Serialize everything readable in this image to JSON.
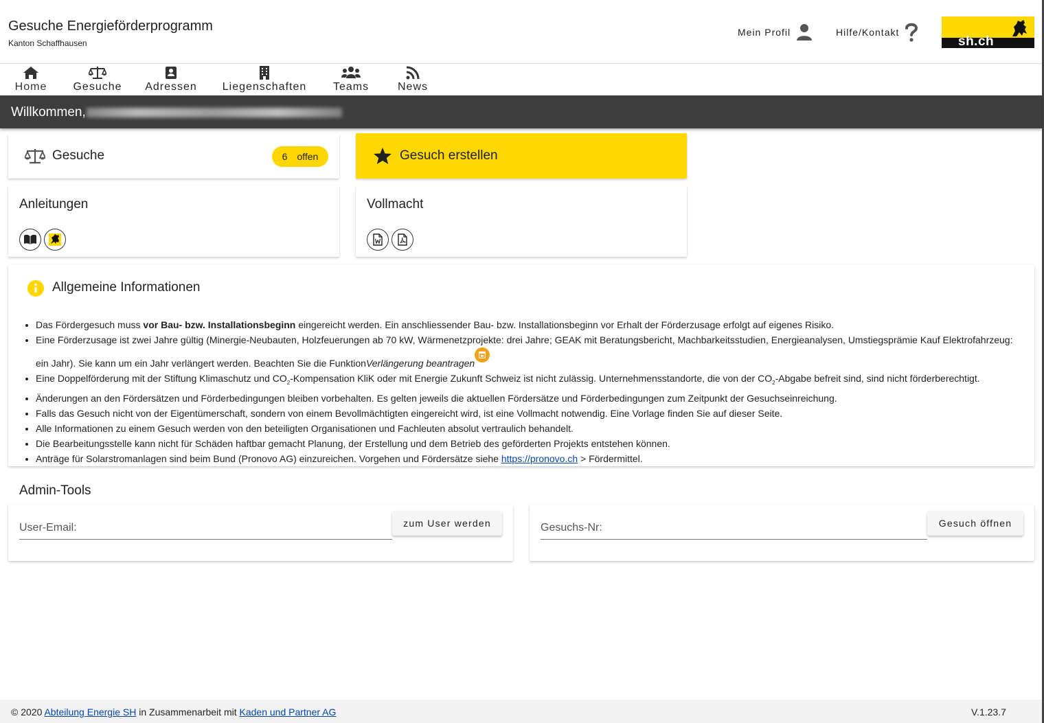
{
  "header": {
    "title": "Gesuche Energieförderprogramm",
    "subtitle": "Kanton Schaffhausen",
    "profile_label": "Mein Profil",
    "help_label": "Hilfe/Kontakt",
    "logo_text": "sh.ch"
  },
  "nav": {
    "items": [
      {
        "label": "Home",
        "icon": "home-icon"
      },
      {
        "label": "Gesuche",
        "icon": "scale-icon"
      },
      {
        "label": "Adressen",
        "icon": "address-book-icon"
      },
      {
        "label": "Liegenschaften",
        "icon": "building-icon"
      },
      {
        "label": "Teams",
        "icon": "users-icon"
      },
      {
        "label": "News",
        "icon": "rss-icon"
      }
    ],
    "active": "Home"
  },
  "welcome": {
    "text": "Willkommen,"
  },
  "cards": {
    "gesuche": {
      "title": "Gesuche",
      "count": "6",
      "count_label": "offen"
    },
    "create": {
      "title": "Gesuch erstellen"
    },
    "anleitungen": {
      "title": "Anleitungen",
      "icons": [
        "book-icon",
        "canton-logo-icon"
      ]
    },
    "vollmacht": {
      "title": "Vollmacht",
      "icons": [
        "word-file-icon",
        "pdf-file-icon"
      ]
    }
  },
  "info": {
    "title": "Allgemeine Informationen",
    "items": {
      "i1_pre": "Das Fördergesuch muss ",
      "i1_bold": "vor Bau- bzw. Installationsbeginn",
      "i1_post": " eingereicht werden. Ein anschliessender Bau- bzw. Installationsbeginn vor Erhalt der Förderzusage erfolgt auf eigenes Risiko.",
      "i2_a": "Eine Förderzusage ist zwei Jahre gültig (Minergie-Neubauten, Holzfeuerungen ab 70 kW, Wärmenetzprojekte: drei Jahre; GEAK mit Beratungsbericht, Machbarkeitsstudien, Energieanalysen, Umstiegsprämie Kauf Elektrofahrzeug:",
      "i2_b": "ein Jahr). Sie kann um ein Jahr verlängert werden. Beachten Sie die Funktion ",
      "i2_italic": "Verlängerung beantragen",
      "i3_a": "Eine Doppelförderung mit der Stiftung Klimaschutz und CO",
      "i3_sub1": "2",
      "i3_b": "-Kompensation KliK oder mit Energie Zukunft Schweiz ist nicht zulässig. Unternehmensstandorte, die von der CO",
      "i3_sub2": "2",
      "i3_c": "-Abgabe befreit sind, sind nicht förderberechtigt.",
      "i4": "Änderungen an den Fördersätzen und Förderbedingungen bleiben vorbehalten. Es gelten jeweils die aktuellen Fördersätze und Förderbedingungen zum Zeitpunkt der Gesuchseinreichung.",
      "i5": "Falls das Gesuch nicht von der Eigentümerschaft, sondern von einem Bevollmächtigten eingereicht wird, ist eine Vollmacht notwendig. Eine Vorlage finden Sie auf dieser Seite.",
      "i6": "Alle Informationen zu einem Gesuch werden von den beteiligten Organisationen und Fachleuten absolut vertraulich behandelt.",
      "i7": "Die Bearbeitungsstelle kann nicht für Schäden haftbar gemacht Planung, der Erstellung und dem Betrieb des geförderten Projekts entstehen können.",
      "i8_pre": "Anträge für Solarstromanlagen sind beim Bund (Pronovo AG) einzureichen. Vorgehen und Fördersätze siehe ",
      "i8_link": "https://pronovo.ch",
      "i8_post": " > Fördermittel."
    }
  },
  "admin": {
    "title": "Admin-Tools",
    "user_email_label": "User-Email:",
    "user_email_value": "",
    "become_user_button": "zum User werden",
    "gesuch_nr_label": "Gesuchs-Nr:",
    "gesuch_nr_value": "",
    "open_gesuch_button": "Gesuch öffnen"
  },
  "footer": {
    "copyright": "© 2020 ",
    "link1": "Abteilung Energie SH",
    "middle": " in Zusammenarbeit mit ",
    "link2": " Kaden und Partner AG",
    "version": "V.1.23.7"
  },
  "colors": {
    "accent_yellow": "#ffd800",
    "welcome_bar": "#3d3d3d",
    "link": "#0645ad",
    "orange": "#f4a11a"
  }
}
